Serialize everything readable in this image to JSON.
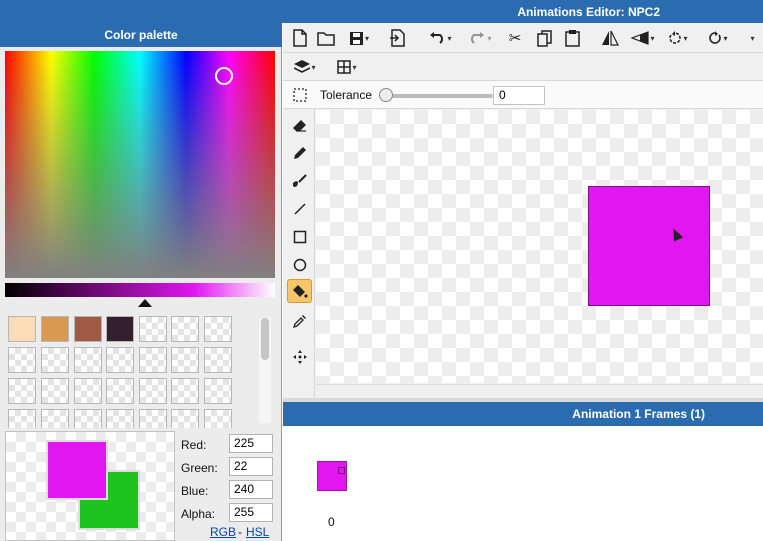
{
  "window": {
    "title": "Animations Editor: NPC2"
  },
  "color_palette": {
    "title": "Color palette",
    "swatches": [
      "#fcdcb6",
      "#d89a51",
      "#a05b45",
      "#34202c"
    ],
    "primary_color": "#e116f0",
    "secondary_color": "#1ec41e",
    "red_label": "Red:",
    "green_label": "Green:",
    "blue_label": "Blue:",
    "alpha_label": "Alpha:",
    "red": "225",
    "green": "22",
    "blue": "240",
    "alpha": "255",
    "rgb_link": "RGB",
    "separator": "-",
    "hsl_link": "HSL"
  },
  "toolbar": {
    "icons": [
      "new-file-icon",
      "open-folder-icon",
      "save-icon",
      "export-icon",
      "undo-icon",
      "redo-icon",
      "cut-icon",
      "copy-icon",
      "paste-icon",
      "flip-horizontal-icon",
      "flip-vertical-icon",
      "rotate-left-icon",
      "rotate-right-icon",
      "layers-icon",
      "grid-icon"
    ]
  },
  "tolerance": {
    "label": "Tolerance",
    "value": "0",
    "level": 0
  },
  "tools": [
    "select-icon",
    "eraser-icon",
    "pencil-icon",
    "brush-icon",
    "line-icon",
    "rectangle-icon",
    "ellipse-icon",
    "fill-bucket-icon",
    "eyedropper-icon",
    "move-icon"
  ],
  "active_tool": "fill-bucket-icon",
  "frames": {
    "title": "Animation 1 Frames (1)",
    "frame_number": "0"
  }
}
